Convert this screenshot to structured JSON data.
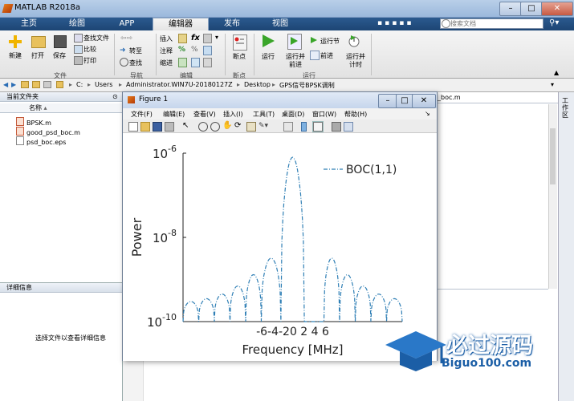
{
  "window": {
    "title": "MATLAB R2018a",
    "controls": [
      "–",
      "□",
      "✕"
    ]
  },
  "tabs": [
    {
      "label": "主页",
      "active": false
    },
    {
      "label": "绘图",
      "active": false
    },
    {
      "label": "APP",
      "active": false
    },
    {
      "label": "编辑器",
      "active": true
    },
    {
      "label": "发布",
      "active": false
    },
    {
      "label": "视图",
      "active": false
    }
  ],
  "search": {
    "placeholder": "搜索文档"
  },
  "ribbon": {
    "file": {
      "new": "新建",
      "open": "打开",
      "save": "保存",
      "find_files": "查找文件",
      "compare": "比较",
      "print": "打印",
      "group": "文件"
    },
    "nav": {
      "goto": "转至",
      "find": "查找",
      "group": "导航"
    },
    "edit": {
      "insert": "插入",
      "comment": "注释",
      "indent": "缩进",
      "fx": "fx",
      "group": "编辑"
    },
    "breakpoints": {
      "label": "断点",
      "group": "断点"
    },
    "run": {
      "run": "运行",
      "run_advance": [
        "运行并",
        "前进"
      ],
      "run_section": "运行节",
      "advance": "前进",
      "run_time": [
        "运行并",
        "计时"
      ],
      "group": "运行"
    }
  },
  "address": {
    "parts": [
      "C:",
      "Users",
      "Administrator.WIN7U-20180127Z",
      "Desktop",
      "GPS信号BPSK调制"
    ]
  },
  "left_panel": {
    "current_folder": "当前文件夹",
    "name_header": "名称",
    "files": [
      "BPSK.m",
      "good_psd_boc.m",
      "psd_boc.eps"
    ],
    "details_header": "详细信息",
    "details_hint": "选择文件以查看详细信息"
  },
  "editor_tab_partial": "_boc.m",
  "right_strip_label": "工作区",
  "figure": {
    "title": "Figure 1",
    "menu": [
      "文件(F)",
      "编辑(E)",
      "查看(V)",
      "插入(I)",
      "工具(T)",
      "桌面(D)",
      "窗口(W)",
      "帮助(H)"
    ]
  },
  "chart_data": {
    "type": "line",
    "title": "",
    "xlabel": "Frequency [MHz]",
    "ylabel": "Power",
    "yscale": "log",
    "ylim": [
      1e-10,
      1e-06
    ],
    "xlim": [
      -14,
      14
    ],
    "yticks": [
      {
        "value": 1e-06,
        "label": "10",
        "exp": "-6"
      },
      {
        "value": 1e-08,
        "label": "10",
        "exp": "-8"
      },
      {
        "value": 1e-10,
        "label": "10",
        "exp": "-10"
      }
    ],
    "xtick_labels": "-6-4-20 2 4 6",
    "legend": {
      "entries": [
        "BOC(1,1)"
      ],
      "placement": "top-right"
    },
    "grid": false,
    "series": [
      {
        "name": "BOC(1,1)",
        "color": "#2f7fb5",
        "style": "dash-dot",
        "lobes": [
          {
            "center": -13,
            "peak": 3e-10
          },
          {
            "center": -11,
            "peak": 3.5e-10
          },
          {
            "center": -9,
            "peak": 4.5e-10
          },
          {
            "center": -7,
            "peak": 7e-10
          },
          {
            "center": -5,
            "peak": 1.3e-09
          },
          {
            "center": -3,
            "peak": 3.2e-09
          },
          {
            "center": 0,
            "peak": 8e-07
          },
          {
            "center": 3,
            "peak": 3.2e-09
          },
          {
            "center": 5,
            "peak": 1.3e-09
          },
          {
            "center": 7,
            "peak": 7e-10
          },
          {
            "center": 9,
            "peak": 4.5e-10
          },
          {
            "center": 11,
            "peak": 3.5e-10
          },
          {
            "center": 13,
            "peak": 3e-10
          }
        ]
      }
    ]
  },
  "watermark": {
    "cn": "必过源码",
    "url": "Biguo100.com"
  }
}
